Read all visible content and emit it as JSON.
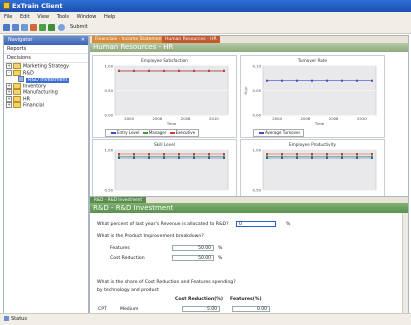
{
  "window": {
    "title": "ExTrain Client"
  },
  "menu": [
    "File",
    "Edit",
    "View",
    "Tools",
    "Window",
    "Help"
  ],
  "toolbar": {
    "submit_label": "Submit"
  },
  "navigator": {
    "title": "Navigator",
    "reports_label": "Reports",
    "decisions_label": "Decisions",
    "tree": [
      {
        "label": "Marketing Strategy",
        "level": 0,
        "expander": "+"
      },
      {
        "label": "R&D",
        "level": 0,
        "expander": "-"
      },
      {
        "label": "R&D Investment",
        "level": 1,
        "selected": true
      },
      {
        "label": "Inventory",
        "level": 0,
        "expander": "+"
      },
      {
        "label": "Manufacturing",
        "level": 0,
        "expander": "+"
      },
      {
        "label": "HR",
        "level": 0,
        "expander": "+"
      },
      {
        "label": "Financial",
        "level": 0,
        "expander": "+"
      }
    ]
  },
  "main": {
    "tabs": [
      "Financials - Income Statement",
      "Human Resources - HR"
    ],
    "section_title": "Human Resources - HR"
  },
  "chart_data": [
    {
      "type": "line",
      "title": "Employee Satisfaction",
      "xlabel": "Time",
      "x_ticks": [
        "2004",
        "2006",
        "2008",
        "2010"
      ],
      "y_ticks": [
        "0.00",
        "0.50",
        "1.00"
      ],
      "series": [
        {
          "name": "Entry Level",
          "color": "#3b4fc9",
          "values": [
            0.9,
            0.9,
            0.9,
            0.9,
            0.9,
            0.9,
            0.9,
            0.9
          ]
        },
        {
          "name": "Manager",
          "color": "#3b9a3b",
          "values": [
            0.9,
            0.9,
            0.9,
            0.9,
            0.9,
            0.9,
            0.9,
            0.9
          ]
        },
        {
          "name": "Executive",
          "color": "#d43b3b",
          "values": [
            0.9,
            0.9,
            0.9,
            0.9,
            0.9,
            0.9,
            0.9,
            0.9
          ]
        }
      ]
    },
    {
      "type": "line",
      "title": "Turnover Rate",
      "xlabel": "Time",
      "ylabel": "%/yr",
      "x_ticks": [
        "2004",
        "2006",
        "2008",
        "2010"
      ],
      "y_ticks": [
        "0.00",
        "0.05",
        "0.10"
      ],
      "series": [
        {
          "name": "Average Turnover",
          "color": "#3b4fc9",
          "values": [
            0.07,
            0.07,
            0.07,
            0.07,
            0.07,
            0.07,
            0.07,
            0.07
          ]
        }
      ]
    },
    {
      "type": "line",
      "title": "Skill Level",
      "x_ticks": [],
      "y_ticks": [
        "0.50",
        "1.00"
      ],
      "series": [
        {
          "name": "Entry Level",
          "color": "#3b4fc9",
          "values": [
            0.9,
            0.9,
            0.9,
            0.9,
            0.9,
            0.9,
            0.9,
            0.9
          ]
        },
        {
          "name": "Manager",
          "color": "#3b9a3b",
          "values": [
            0.92,
            0.92,
            0.92,
            0.92,
            0.92,
            0.92,
            0.92,
            0.92
          ]
        },
        {
          "name": "Executive",
          "color": "#d43b3b",
          "values": [
            0.95,
            0.95,
            0.95,
            0.95,
            0.95,
            0.95,
            0.95,
            0.95
          ]
        }
      ]
    },
    {
      "type": "line",
      "title": "Employee Productivity",
      "x_ticks": [],
      "y_ticks": [
        "0.50",
        "1.00"
      ],
      "series": [
        {
          "name": "Entry Level",
          "color": "#3b4fc9",
          "values": [
            0.9,
            0.9,
            0.9,
            0.9,
            0.9,
            0.9,
            0.9,
            0.9
          ]
        },
        {
          "name": "Manager",
          "color": "#3b9a3b",
          "values": [
            0.92,
            0.92,
            0.92,
            0.92,
            0.92,
            0.92,
            0.92,
            0.92
          ]
        },
        {
          "name": "Executive",
          "color": "#d43b3b",
          "values": [
            0.95,
            0.95,
            0.95,
            0.95,
            0.95,
            0.95,
            0.95,
            0.95
          ]
        }
      ]
    }
  ],
  "rd_panel": {
    "tab_label": "R&D - R&D Investment",
    "title": "R&D - R&D Investment",
    "q1": "What percent of last year's Revenue is allocated to R&D?",
    "q1_value": "0",
    "q1_unit": "%",
    "q2": "What is the Product Improvement breakdown?",
    "features_label": "Features",
    "features_value": "50.00",
    "features_unit": "%",
    "costred_label": "Cost Reduction",
    "costred_value": "50.00",
    "costred_unit": "%",
    "q3": "What is the share of Cost Reduction and Features spending?",
    "q3b": "by technology and product",
    "col1": "Cost Reduction(%)",
    "col2": "Features(%)",
    "row_tech": "CPT",
    "row_prod": "Medium",
    "row_v1": "5.00",
    "row_v2": "0.00"
  },
  "status": {
    "label": "Status"
  }
}
